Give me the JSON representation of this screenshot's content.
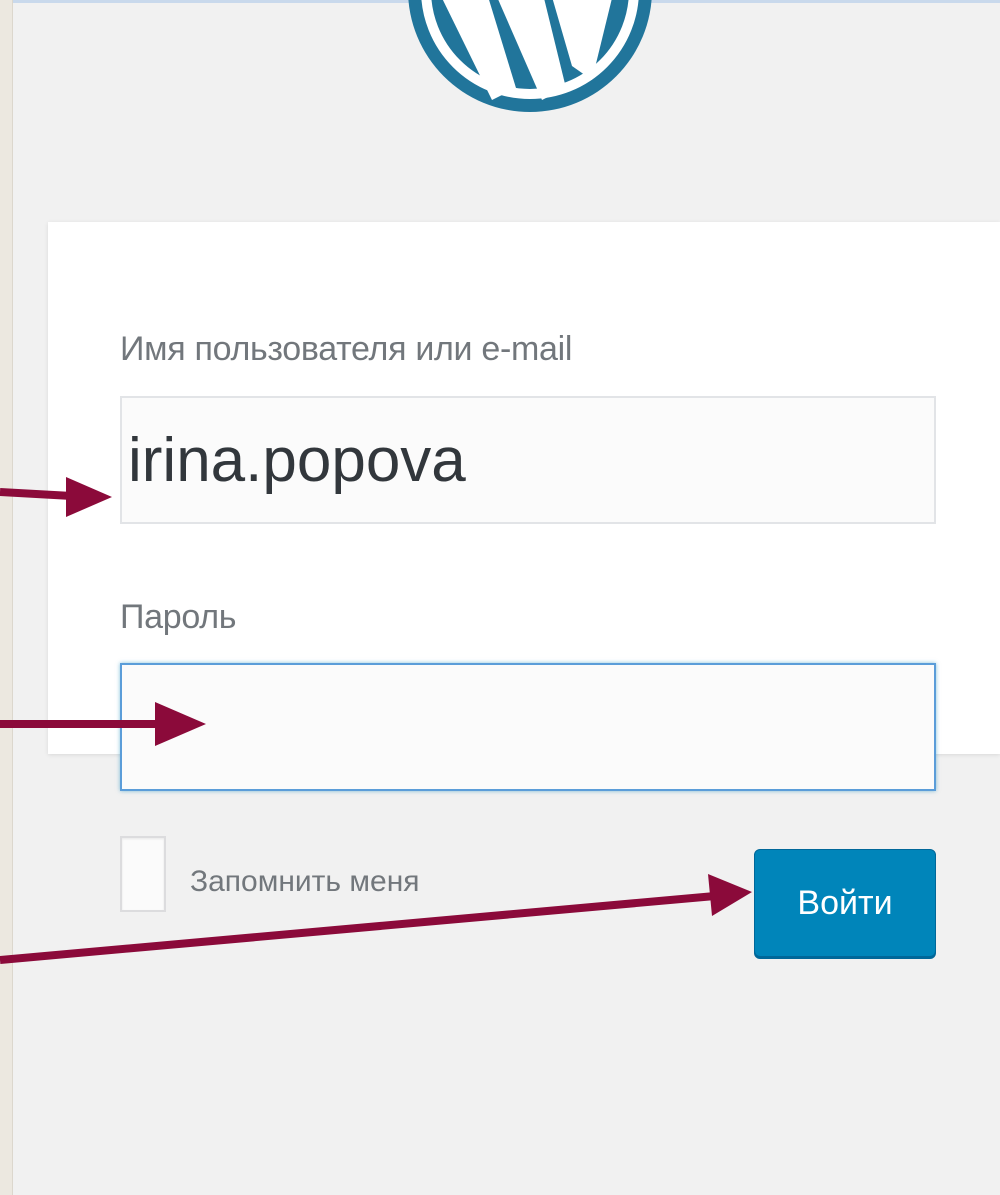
{
  "login_form": {
    "username_label": "Имя пользователя или e-mail",
    "username_value": "irina.popova",
    "password_label": "Пароль",
    "password_value": "",
    "remember_label": "Запомнить меня",
    "remember_checked": false,
    "submit_label": "Войти"
  },
  "logo": {
    "icon": "wordpress-logo-icon"
  },
  "colors": {
    "accent": "#0085ba",
    "logo": "#21759b",
    "annotation_arrow": "#8b0a3a",
    "page_background": "#f1f1f1",
    "label_text": "#72777c",
    "focus_border": "#5b9dd9"
  }
}
